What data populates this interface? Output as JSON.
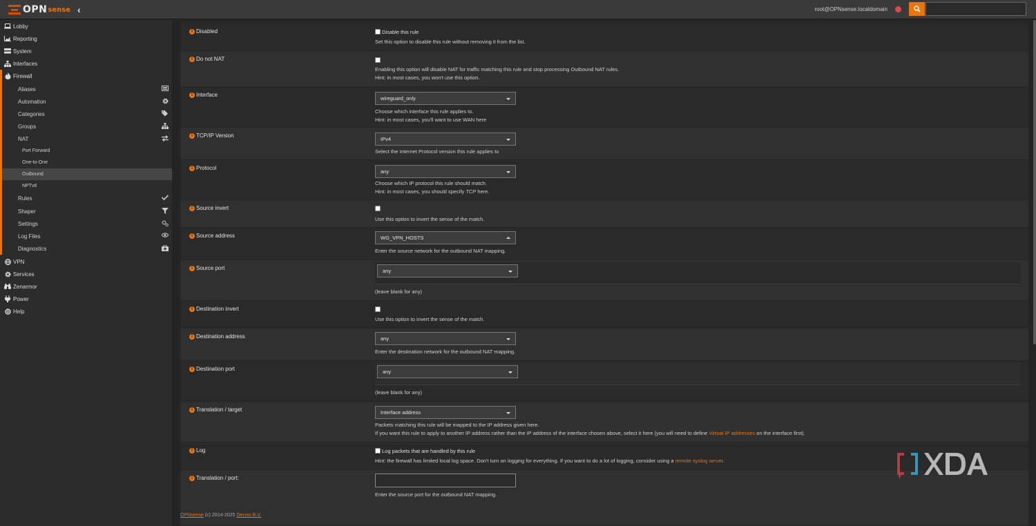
{
  "brand": {
    "name_opn": "OPN",
    "name_sense": "sense"
  },
  "topbar": {
    "user": "root@OPNsense.localdomain",
    "search_placeholder": "",
    "search_value": ""
  },
  "sidebar": {
    "main": [
      {
        "label": "Lobby",
        "icon": "laptop-icon"
      },
      {
        "label": "Reporting",
        "icon": "area-chart-icon"
      },
      {
        "label": "System",
        "icon": "server-icon"
      },
      {
        "label": "Interfaces",
        "icon": "sitemap-icon"
      },
      {
        "label": "Firewall",
        "icon": "fire-icon"
      }
    ],
    "firewall_items": [
      {
        "label": "Aliases",
        "icon": "list-icon"
      },
      {
        "label": "Automation",
        "icon": "cog-icon"
      },
      {
        "label": "Categories",
        "icon": "tags-icon"
      },
      {
        "label": "Groups",
        "icon": "sitemap-icon"
      },
      {
        "label": "NAT",
        "icon": "exchange-icon"
      }
    ],
    "nat_items": [
      {
        "label": "Port Forward"
      },
      {
        "label": "One-to-One"
      },
      {
        "label": "Outbound",
        "active": true
      },
      {
        "label": "NPTv6"
      }
    ],
    "firewall_items2": [
      {
        "label": "Rules",
        "icon": "check-icon"
      },
      {
        "label": "Shaper",
        "icon": "filter-icon"
      },
      {
        "label": "Settings",
        "icon": "cogs-icon"
      },
      {
        "label": "Log Files",
        "icon": "eye-icon"
      },
      {
        "label": "Diagnostics",
        "icon": "medkit-icon"
      }
    ],
    "bottom": [
      {
        "label": "VPN",
        "icon": "globe-icon"
      },
      {
        "label": "Services",
        "icon": "cog-icon"
      },
      {
        "label": "Zenarmor",
        "icon": "binoculars-icon"
      },
      {
        "label": "Power",
        "icon": "plug-icon"
      },
      {
        "label": "Help",
        "icon": "life-ring-icon"
      }
    ]
  },
  "form": {
    "disabled": {
      "label": "Disabled",
      "checkbox_label": "Disable this rule",
      "help": "Set this option to disable this rule without removing it from the list."
    },
    "do_not_nat": {
      "label": "Do not NAT",
      "help1": "Enabling this option will disable NAT for traffic matching this rule and stop processing Outbound NAT rules.",
      "help2": "Hint: in most cases, you won't use this option."
    },
    "interface": {
      "label": "Interface",
      "value": "wireguard_only",
      "help1": "Choose which interface this rule applies to.",
      "help2": "Hint: in most cases, you'll want to use WAN here"
    },
    "tcpip": {
      "label": "TCP/IP Version",
      "value": "IPv4",
      "help": "Select the Internet Protocol version this rule applies to"
    },
    "protocol": {
      "label": "Protocol",
      "value": "any",
      "help1": "Choose which IP protocol this rule should match.",
      "help2_pre": "Hint: in most cases, you should specify ",
      "help2_em": "TCP",
      "help2_post": " here."
    },
    "source_invert": {
      "label": "Source invert",
      "help": "Use this option to invert the sense of the match."
    },
    "source_address": {
      "label": "Source address",
      "value": "WG_VPN_HOSTS",
      "help": "Enter the source network for the outbound NAT mapping."
    },
    "source_port": {
      "label": "Source port",
      "value": "any",
      "help": "(leave blank for any)"
    },
    "destination_invert": {
      "label": "Destination invert",
      "help": "Use this option to invert the sense of the match."
    },
    "destination_address": {
      "label": "Destination address",
      "value": "any",
      "help": "Enter the destination network for the outbound NAT mapping."
    },
    "destination_port": {
      "label": "Destination port",
      "value": "any",
      "help": "(leave blank for any)"
    },
    "translation_target": {
      "label": "Translation / target",
      "value": "Interface address",
      "help1": "Packets matching this rule will be mapped to the IP address given here.",
      "help2_pre": "If you want this rule to apply to another IP address rather than the IP address of the interface chosen above, select it here (you will need to define ",
      "help2_link": "Virtual IP addresses",
      "help2_post": " on the interface first)."
    },
    "log": {
      "label": "Log",
      "checkbox_label": "Log packets that are handled by this rule",
      "help_pre": "Hint: the firewall has limited local log space. Don't turn on logging for everything. If you want to do a lot of logging, consider using a ",
      "help_link": "remote syslog server",
      "help_post": "."
    },
    "translation_port": {
      "label": "Translation / port:",
      "value": "",
      "help": "Enter the source port for the outbound NAT mapping."
    }
  },
  "footer": {
    "brand": "OPNsense",
    "copy": " (c) 2014-2025 ",
    "company": "Deciso B.V."
  },
  "watermark": {
    "text": "XDA"
  },
  "colors": {
    "accent": "#e8750f",
    "status_dot": "#e0474c"
  }
}
